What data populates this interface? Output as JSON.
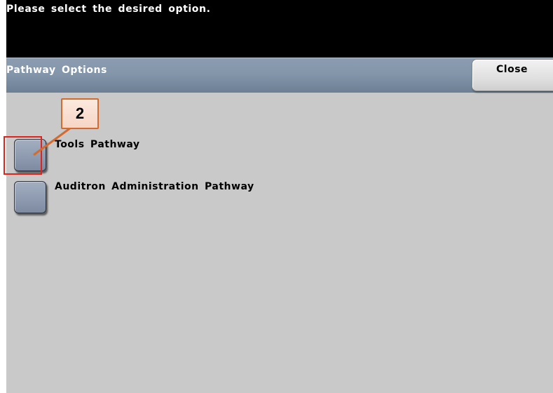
{
  "message_bar": {
    "text": "Please select the desired option."
  },
  "title_bar": {
    "title": "Pathway Options",
    "close_label": "Close"
  },
  "options": [
    {
      "label": "Tools Pathway"
    },
    {
      "label": "Auditron Administration Pathway"
    }
  ],
  "callout": {
    "number": "2",
    "color": "#d46a2e",
    "highlight_color": "#e0231b"
  },
  "colors": {
    "message_bar": "#000000",
    "title_bar": "#8396aa",
    "background": "#c9c9c9",
    "option_button": "#8e9bb0"
  }
}
